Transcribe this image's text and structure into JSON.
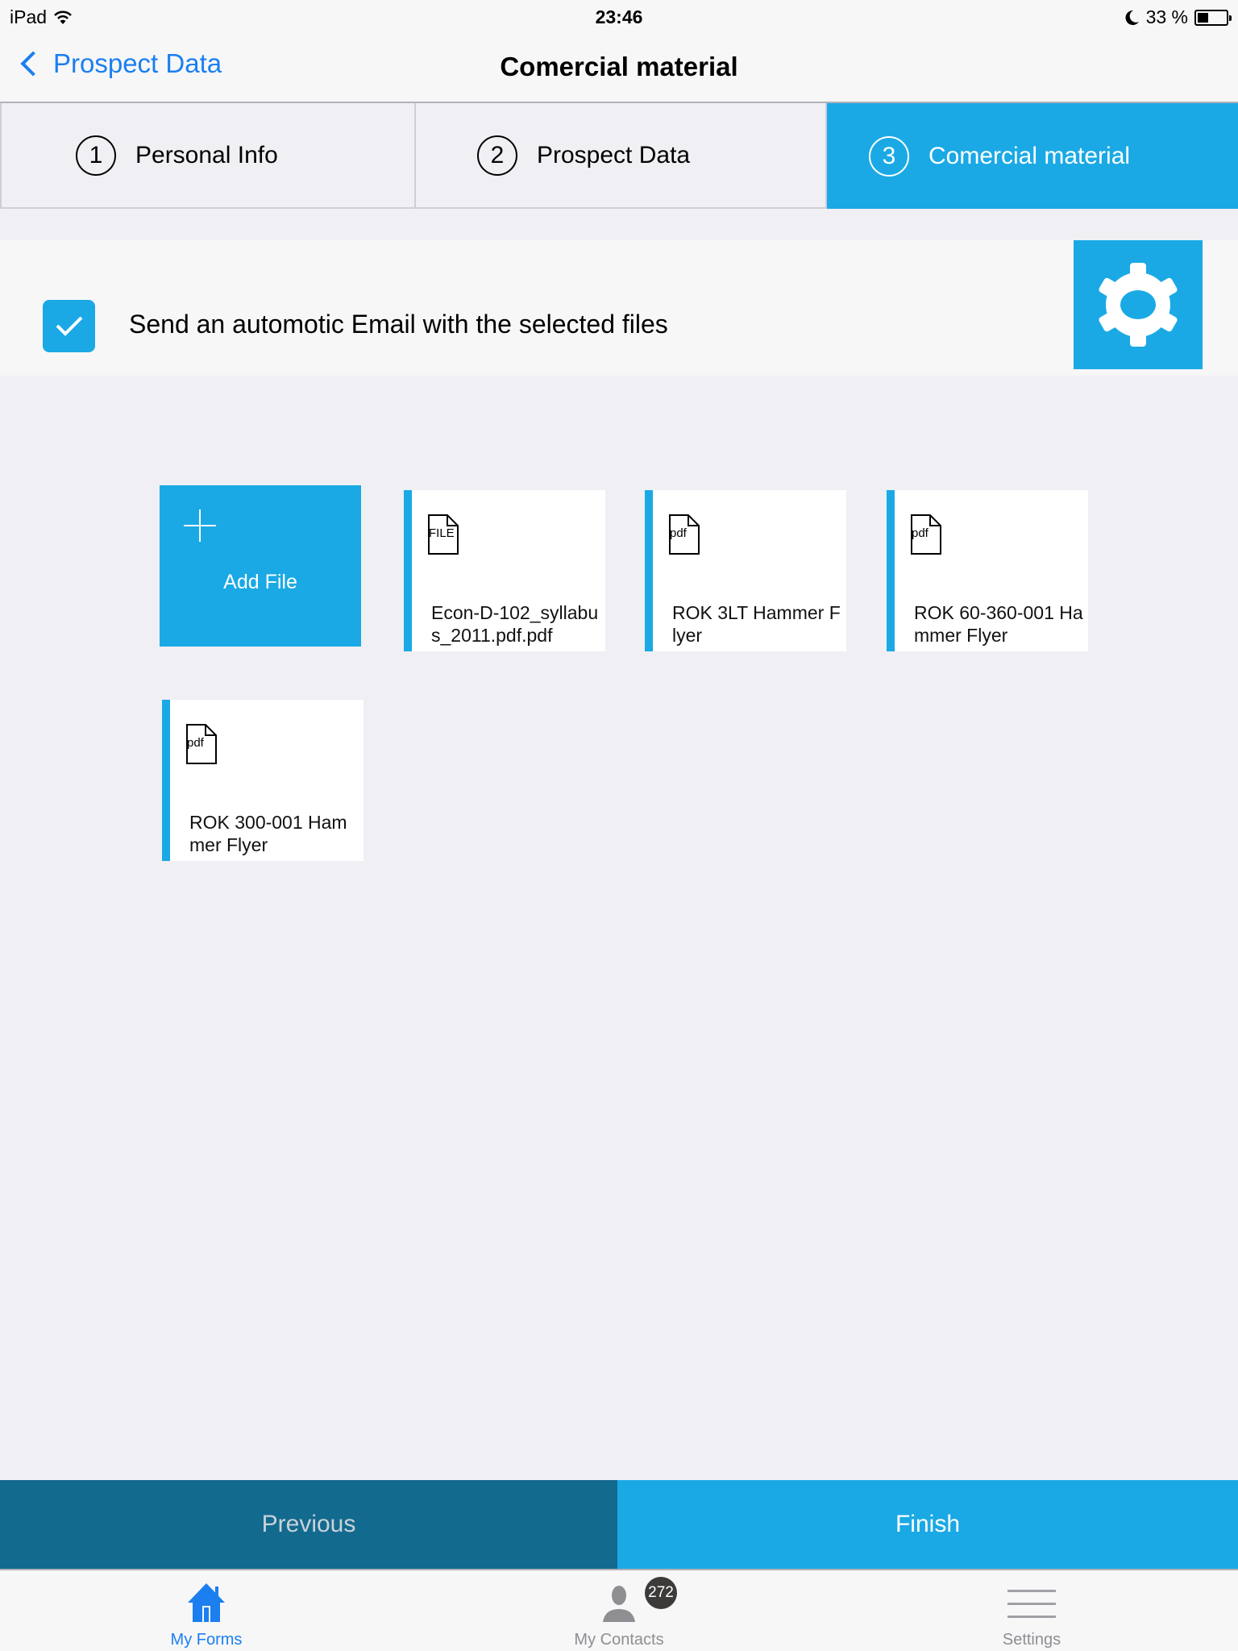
{
  "status_bar": {
    "device": "iPad",
    "time": "23:46",
    "battery_percent_label": "33 %",
    "battery_level": 0.33
  },
  "nav": {
    "back_label": "Prospect Data",
    "title": "Comercial material"
  },
  "steps": [
    {
      "number": "1",
      "label": "Personal Info",
      "active": false
    },
    {
      "number": "2",
      "label": "Prospect Data",
      "active": false
    },
    {
      "number": "3",
      "label": "Comercial material",
      "active": true
    }
  ],
  "email_option": {
    "label": "Send an automotic Email with the selected files",
    "checked": true
  },
  "add_file": {
    "label": "Add File"
  },
  "files": [
    {
      "type_label": "FILE",
      "name": "Econ-D-102_syllabus_2011.pdf.pdf"
    },
    {
      "type_label": "pdf",
      "name": "ROK 3LT Hammer Flyer"
    },
    {
      "type_label": "pdf",
      "name": "ROK 60-360-001 Hammer Flyer"
    },
    {
      "type_label": "pdf",
      "name": "ROK 300-001 Hammer Flyer"
    }
  ],
  "actions": {
    "previous_label": "Previous",
    "finish_label": "Finish"
  },
  "tabbar": {
    "items": [
      {
        "label": "My Forms",
        "icon": "home-icon",
        "active": true
      },
      {
        "label": "My Contacts",
        "icon": "person-icon",
        "active": false
      },
      {
        "label": "Settings",
        "icon": "menu-icon",
        "active": false
      }
    ],
    "contacts_badge": "272"
  },
  "colors": {
    "accent": "#1aa9e5",
    "accent_dark": "#136a8f",
    "ios_blue": "#1b7ff0",
    "badge": "#3d3a3a"
  }
}
